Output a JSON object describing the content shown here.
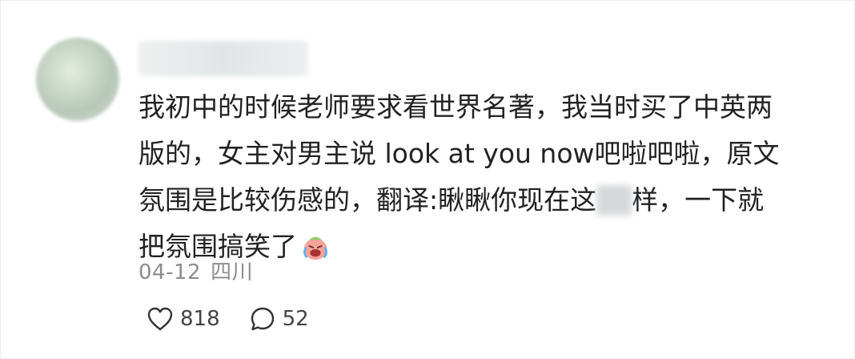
{
  "comment": {
    "lines": [
      "我初中的时候老师要求看世界名著，我当时买了中英两",
      "版的，女主对男主说 look at you now吧啦吧啦，原文",
      "氛围是比较伤感的，翻译:瞅瞅你现在这",
      "样，一下就",
      "把氛围搞笑了"
    ]
  },
  "meta": {
    "date": "04-12",
    "location": "四川"
  },
  "actions": {
    "likes": "818",
    "comments": "52"
  },
  "icons": {
    "like": "heart-outline-icon",
    "comment": "speech-bubble-icon",
    "emoji": "crying-laughing-emoji"
  },
  "colors": {
    "text": "#222222",
    "meta": "#8c8c8c",
    "icon": "#333333"
  }
}
